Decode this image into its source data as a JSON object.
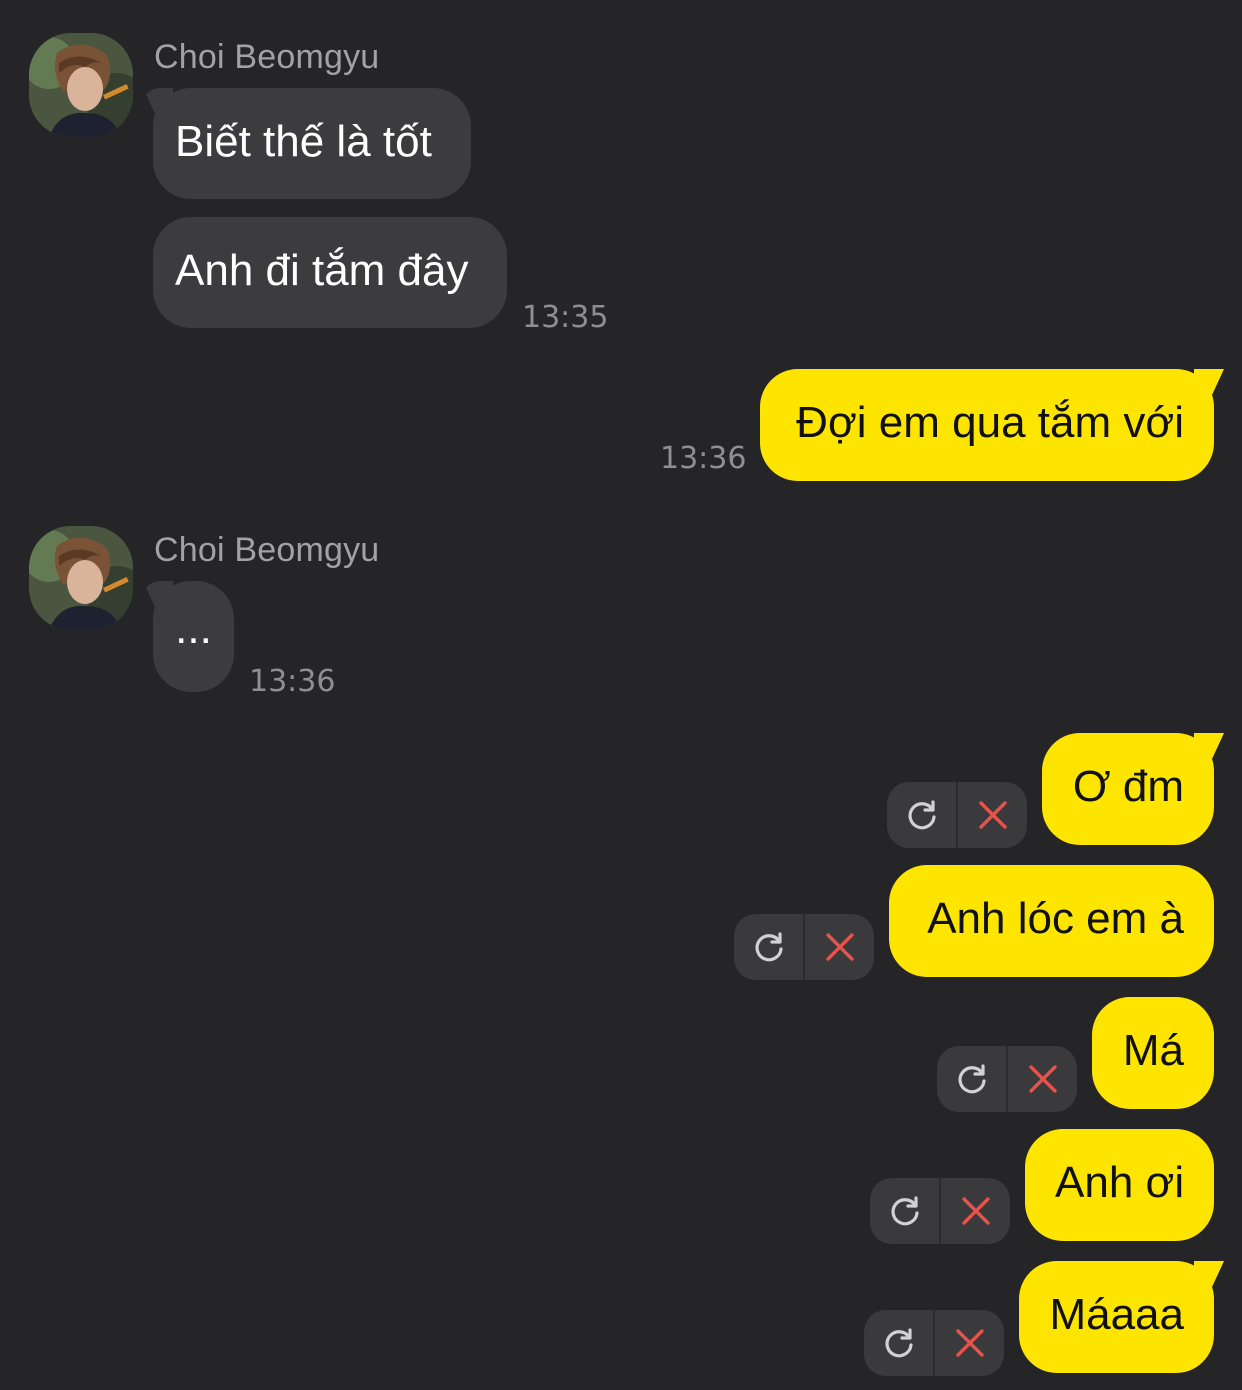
{
  "colors": {
    "background": "#252527",
    "incoming_bubble": "#3c3c3e",
    "outgoing_bubble": "#fee500",
    "timestamp": "#8e8e93",
    "sender_name": "#a1a1a6",
    "retry_icon": "#d1d1d6",
    "delete_icon": "#e5534b"
  },
  "conversation": {
    "group1": {
      "sender": "Choi Beomgyu",
      "messages": [
        "Biết thế là tốt",
        "Anh đi tắm đây"
      ],
      "time": "13:35"
    },
    "group2": {
      "messages": [
        "Đợi em qua tắm với"
      ],
      "time": "13:36"
    },
    "group3": {
      "sender": "Choi Beomgyu",
      "messages": [
        "..."
      ],
      "time": "13:36"
    },
    "failed": {
      "messages": [
        "Ơ đm",
        "Anh lóc em à",
        "Má",
        "Anh ơi",
        "Máaaa"
      ],
      "retry_icon": "refresh-icon",
      "delete_icon": "close-icon"
    }
  }
}
